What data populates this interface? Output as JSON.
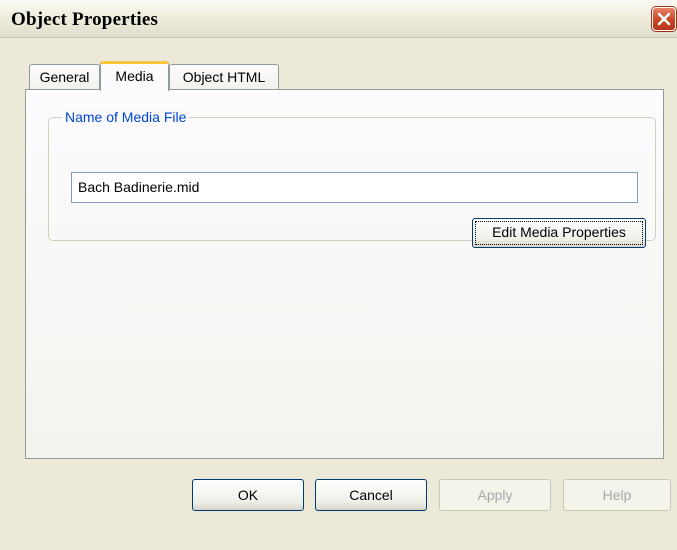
{
  "window": {
    "title": "Object Properties",
    "close_icon": "close-icon",
    "close_color": "#c84626"
  },
  "tabs": [
    {
      "label": "General",
      "selected": false
    },
    {
      "label": "Media",
      "selected": true
    },
    {
      "label": "Object HTML",
      "selected": false
    }
  ],
  "media_panel": {
    "group_label": "Name of Media File",
    "file_name": "Bach Badinerie.mid",
    "edit_button": "Edit Media Properties"
  },
  "buttons": {
    "ok": "OK",
    "cancel": "Cancel",
    "apply": "Apply",
    "help": "Help"
  },
  "colors": {
    "group_label": "#0046d5",
    "active_tab_accent": "#ffc83c",
    "disabled_text": "#a7a6aa"
  }
}
